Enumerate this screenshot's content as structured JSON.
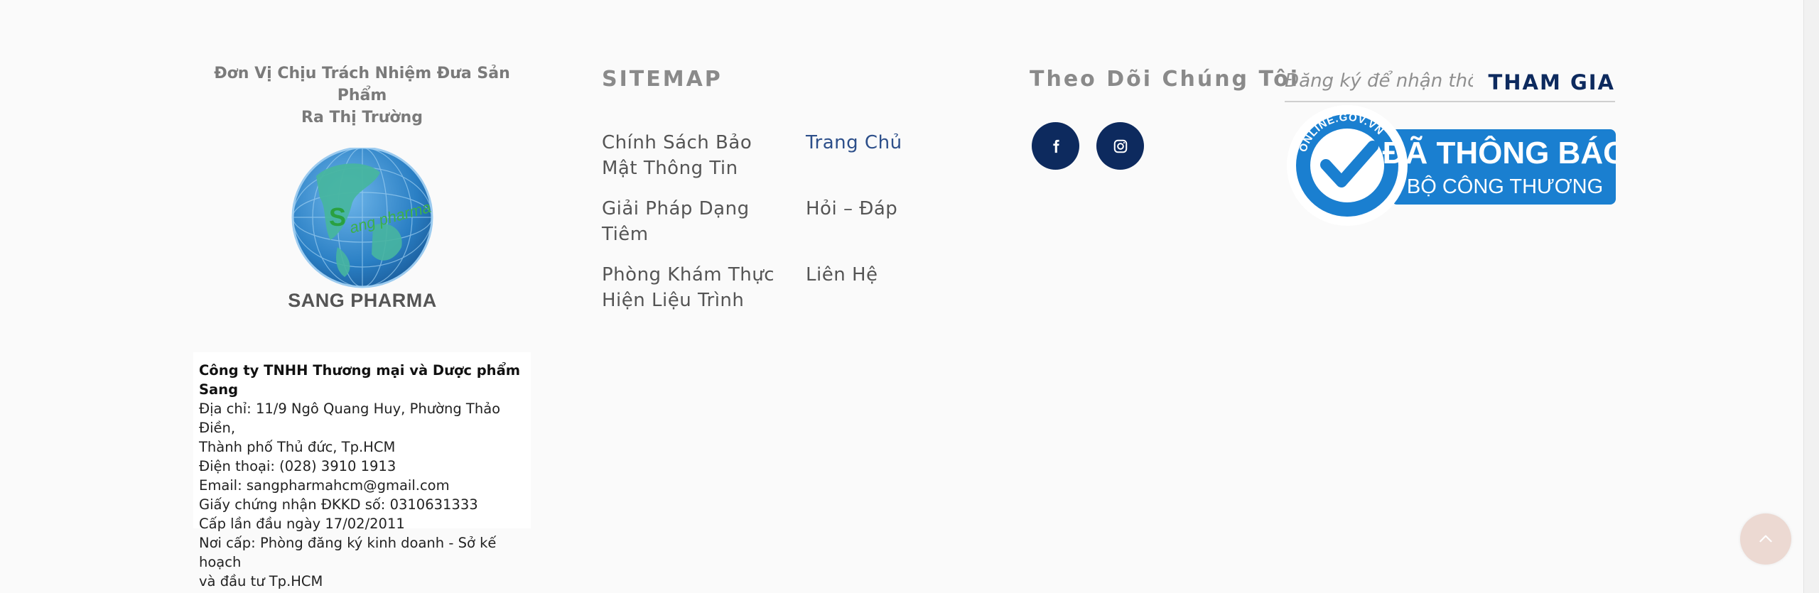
{
  "brand": {
    "responsible_line1": "Đơn Vị Chịu Trách Nhiệm Đưa Sản Phẩm",
    "responsible_line2": "Ra Thị Trường",
    "logo_text": "SANG PHARMA",
    "logo_arc_text": "ang pharma",
    "logo_letter": "S"
  },
  "company": {
    "name": "Công ty TNHH Thương mại và Dược phẩm Sang",
    "address_line1": "Địa chỉ: 11/9 Ngô Quang Huy, Phường Thảo Điền,",
    "address_line2": "Thành phố Thủ đức, Tp.HCM",
    "phone": "Điện thoại:  (028) 3910 1913",
    "email": "Email: sangpharmahcm@gmail.com",
    "license": "Giấy chứng nhận ĐKKD số: 0310631333",
    "issued": "Cấp lần đầu ngày 17/02/2011",
    "issuer_line1": "Nơi cấp: Phòng đăng ký kinh doanh - Sở kế hoạch",
    "issuer_line2": "và đầu tư Tp.HCM"
  },
  "sitemap": {
    "title": "SITEMAP",
    "left_links": [
      {
        "line1": "Chính Sách Bảo",
        "line2": "Mật Thông Tin"
      },
      {
        "line1": "Giải Pháp Dạng",
        "line2": "Tiêm"
      },
      {
        "line1": "Phòng Khám Thực",
        "line2": "Hiện Liệu Trình"
      }
    ],
    "right_links": [
      {
        "label": "Trang Chủ"
      },
      {
        "label": "Hỏi – Đáp"
      },
      {
        "label": "Liên Hệ"
      }
    ]
  },
  "follow": {
    "title": "Theo Dõi Chúng Tôi",
    "facebook_icon": "facebook-icon",
    "instagram_icon": "instagram-icon"
  },
  "subscribe": {
    "placeholder": "Đăng ký để nhận thông tin",
    "button": "THAM GIA"
  },
  "badge": {
    "line1": "ĐÃ THÔNG BÁO",
    "line2": "BỘ CÔNG THƯƠNG",
    "arc": "ONLINE.GOV.VN"
  },
  "colors": {
    "navy": "#0d2a5e",
    "badge_blue": "#1a7fd0",
    "background": "#fafafa"
  }
}
